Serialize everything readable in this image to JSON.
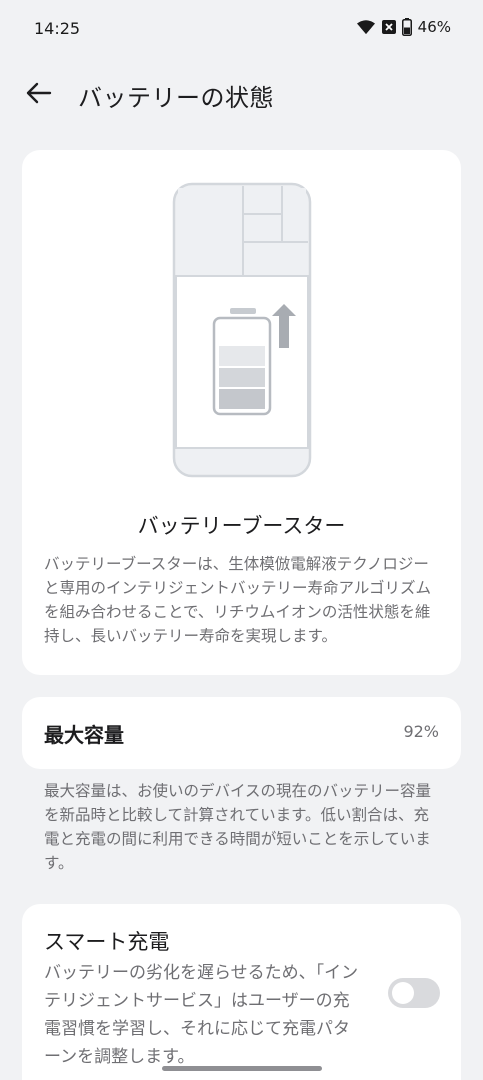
{
  "status_bar": {
    "time": "14:25",
    "battery_percent": "46%",
    "icons": [
      "wifi-icon",
      "no-sim-icon",
      "battery-icon"
    ]
  },
  "header": {
    "title": "バッテリーの状態",
    "back_icon": "arrow-left-icon"
  },
  "booster": {
    "title": "バッテリーブースター",
    "description": "バッテリーブースターは、生体模倣電解液テクノロジーと専用のインテリジェントバッテリー寿命アルゴリズムを組み合わせることで、リチウムイオンの活性状態を維持し、長いバッテリー寿命を実現します。"
  },
  "capacity": {
    "label": "最大容量",
    "value": "92%",
    "description": "最大容量は、お使いのデバイスの現在のバッテリー容量を新品時と比較して計算されています。低い割合は、充電と充電の間に利用できる時間が短いことを示しています。"
  },
  "smart_charging": {
    "title": "スマート充電",
    "description": "バッテリーの劣化を遅らせるため、「インテリジェントサービス」はユーザーの充電習慣を学習し、それに応じて充電パターンを調整します。",
    "enabled": false
  },
  "colors": {
    "background": "#f1f2f4",
    "card": "#ffffff",
    "secondary_text": "#6f6f73",
    "toggle_off": "#d9dadd"
  }
}
